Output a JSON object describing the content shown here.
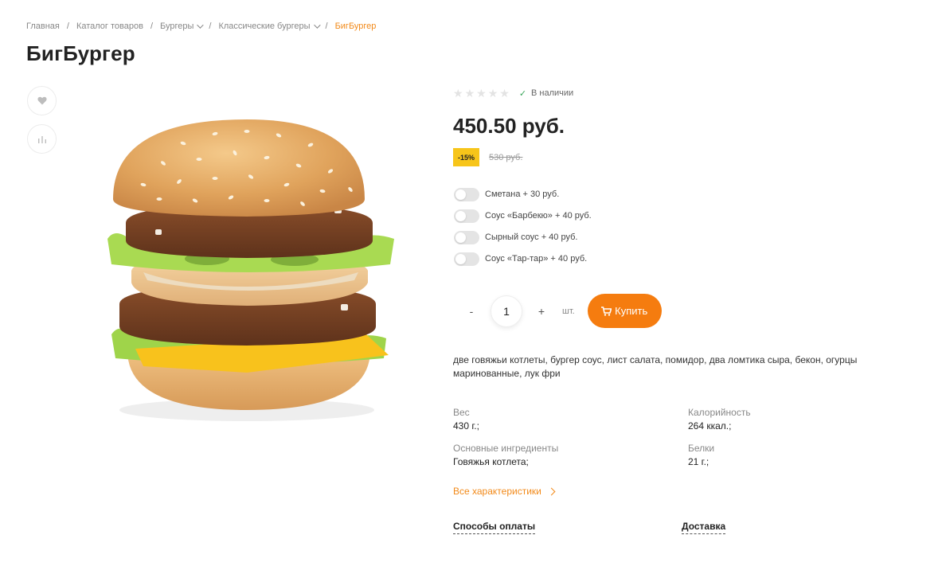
{
  "breadcrumb": {
    "items": [
      {
        "label": "Главная",
        "dropdown": false
      },
      {
        "label": "Каталог товаров",
        "dropdown": false
      },
      {
        "label": "Бургеры",
        "dropdown": true
      },
      {
        "label": "Классические бургеры",
        "dropdown": true
      }
    ],
    "current": "БигБургер",
    "separator": "/"
  },
  "product": {
    "title": "БигБургер",
    "stock_status": "В наличии",
    "rating_stars": 5,
    "price": "450.50 руб.",
    "discount": "-15%",
    "old_price": "530 руб.",
    "options": [
      {
        "label": "Сметана + 30 руб."
      },
      {
        "label": "Соус «Барбекю» + 40 руб."
      },
      {
        "label": "Сырный соус + 40 руб."
      },
      {
        "label": "Соус «Тар-тар» + 40 руб."
      }
    ],
    "quantity": "1",
    "qty_minus": "-",
    "qty_plus": "+",
    "unit": "шт.",
    "buy_label": "Купить",
    "description": "две говяжьи котлеты, бургер соус, лист салата, помидор, два ломтика сыра, бекон, огурцы маринованные, лук фри",
    "characteristics": [
      {
        "label": "Вес",
        "value": "430 г.;"
      },
      {
        "label": "Калорийность",
        "value": "264 ккал.;"
      },
      {
        "label": "Основные ингредиенты",
        "value": "Говяжья котлета;"
      },
      {
        "label": "Белки",
        "value": "21 г.;"
      }
    ],
    "all_characteristics_label": "Все характеристики",
    "payment_label": "Способы оплаты",
    "delivery_label": "Доставка"
  },
  "icons": {
    "favorite": "heart-icon",
    "compare": "bar-chart-icon",
    "cart": "cart-icon",
    "check": "check-icon",
    "star": "star-icon"
  },
  "colors": {
    "accent": "#f57c0f",
    "link": "#f28a1a",
    "badge": "#f7c51a",
    "stock_check": "#3aa55a"
  }
}
